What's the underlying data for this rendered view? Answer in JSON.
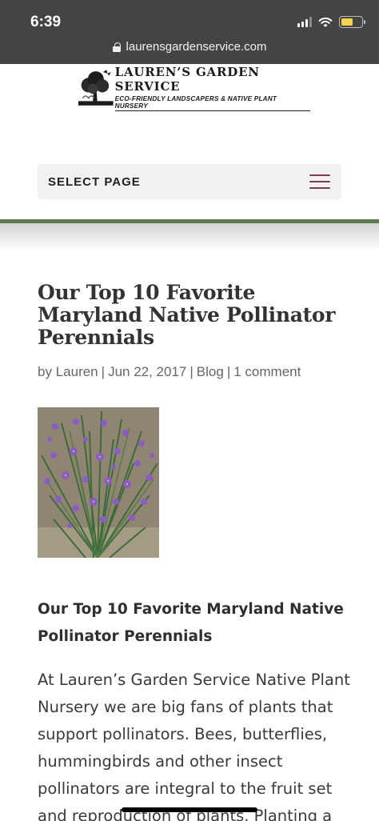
{
  "status": {
    "time": "6:39"
  },
  "browser": {
    "url": "laurensgardenservice.com"
  },
  "header": {
    "logo_title": "LAUREN’S GARDEN SERVICE",
    "logo_subtitle": "ECO-FRIENDLY LANDSCAPERS & NATIVE PLANT NURSERY",
    "menu_label": "SELECT PAGE"
  },
  "article": {
    "title": "Our Top 10 Favorite Maryland Native Pollinator Perennials",
    "meta": {
      "by": "by",
      "author": "Lauren",
      "date": "Jun 22, 2017",
      "category": "Blog",
      "comments": "1 comment"
    },
    "subheading": "Our Top 10 Favorite Maryland Native Pollinator Perennials",
    "body": "At Lauren’s Garden Service Native Plant Nursery we are big fans of plants that support pollinators. Bees, butterflies, hummingbirds and other insect pollinators are integral to the fruit set and reproduction of plants. Planting a"
  },
  "colors": {
    "chrome": "#434545",
    "accent_green": "#5d7a52",
    "hamburger": "#7b3f4a",
    "battery": "#f6d34a"
  }
}
